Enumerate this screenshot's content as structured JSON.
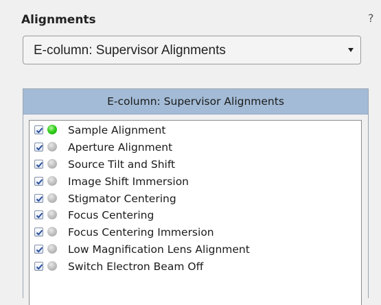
{
  "header": {
    "title": "Alignments",
    "help_label": "?"
  },
  "dropdown": {
    "selected": "E-column: Supervisor Alignments"
  },
  "panel": {
    "title": "E-column: Supervisor Alignments",
    "items": [
      {
        "label": "Sample Alignment",
        "checked": true,
        "status": "green"
      },
      {
        "label": "Aperture Alignment",
        "checked": true,
        "status": "grey"
      },
      {
        "label": "Source Tilt and Shift",
        "checked": true,
        "status": "grey"
      },
      {
        "label": "Image Shift Immersion",
        "checked": true,
        "status": "grey"
      },
      {
        "label": "Stigmator Centering",
        "checked": true,
        "status": "grey"
      },
      {
        "label": "Focus Centering",
        "checked": true,
        "status": "grey"
      },
      {
        "label": "Focus Centering Immersion",
        "checked": true,
        "status": "grey"
      },
      {
        "label": "Low Magnification Lens Alignment",
        "checked": true,
        "status": "grey"
      },
      {
        "label": "Switch Electron Beam Off",
        "checked": true,
        "status": "grey"
      }
    ]
  },
  "colors": {
    "panel_header_bg": "#a3bbd6",
    "status_done": "#33d11c",
    "status_pending": "#c4c4c4"
  }
}
